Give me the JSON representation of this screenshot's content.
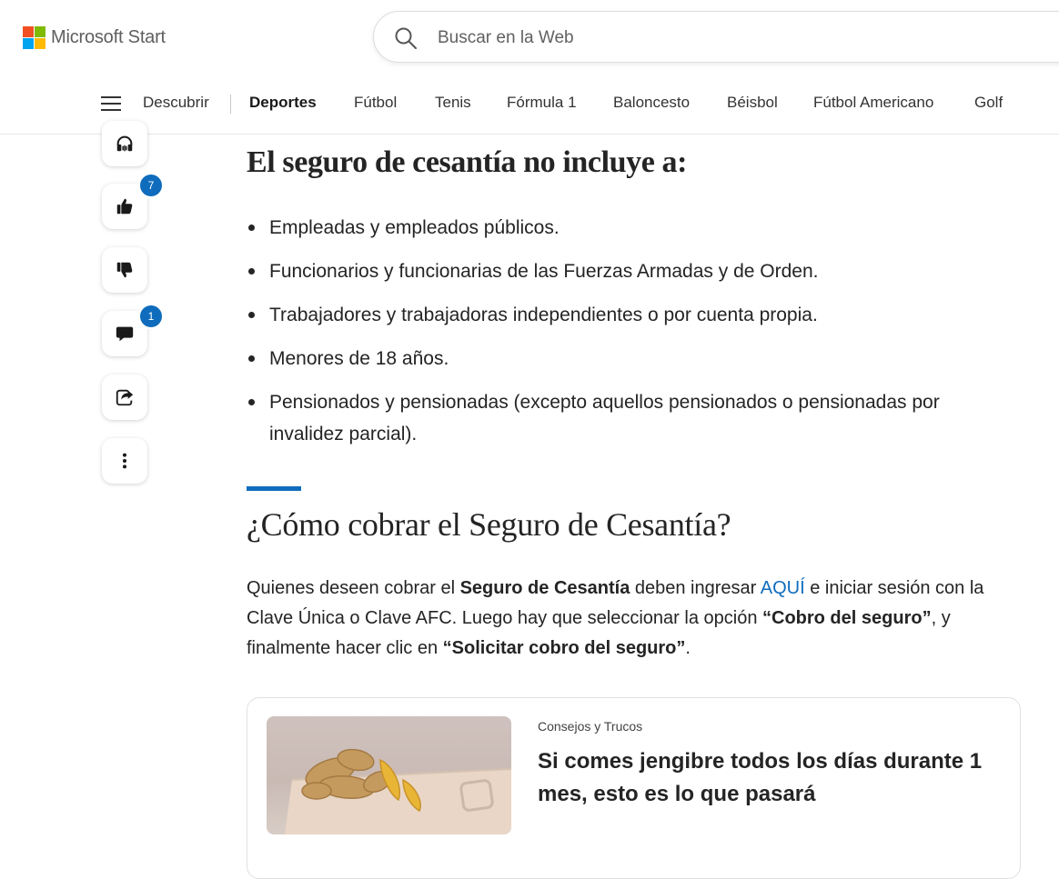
{
  "header": {
    "brand": "Microsoft Start",
    "search_placeholder": "Buscar en la Web",
    "logo_colors": [
      "#f25022",
      "#7fba00",
      "#00a4ef",
      "#ffb900"
    ]
  },
  "nav": {
    "items": [
      {
        "label": "Descubrir"
      },
      {
        "label": "Deportes",
        "active": true
      },
      {
        "label": "Fútbol"
      },
      {
        "label": "Tenis"
      },
      {
        "label": "Fórmula 1"
      },
      {
        "label": "Baloncesto"
      },
      {
        "label": "Béisbol"
      },
      {
        "label": "Fútbol Americano"
      },
      {
        "label": "Golf"
      }
    ]
  },
  "actions": {
    "listen_icon": "headphones-icon",
    "like_icon": "thumbs-up-icon",
    "like_count": "7",
    "dislike_icon": "thumbs-down-icon",
    "comment_icon": "comment-icon",
    "comment_count": "1",
    "share_icon": "share-icon",
    "more_icon": "more-vertical-icon",
    "badge_color": "#0f6cbd"
  },
  "article": {
    "subheading": "El seguro de cesantía no incluye a:",
    "exclusions": [
      "Empleadas y empleados públicos.",
      "Funcionarios y funcionarias de las Fuerzas Armadas y de Orden.",
      "Trabajadores y trabajadoras independientes o por cuenta propia.",
      "Menores de 18 años.",
      "Pensionados y pensionadas (excepto aquellos pensionados o pensionadas por invalidez parcial)."
    ],
    "section_heading": "¿Cómo cobrar el Seguro de Cesantía?",
    "paragraph": {
      "t1": "Quienes deseen cobrar el ",
      "b1": "Seguro de Cesantía",
      "t2": " deben ingresar ",
      "link": "AQUÍ",
      "t3": " e iniciar sesión con la Clave Única o Clave AFC. Luego hay que seleccionar la opción ",
      "b2": "“Cobro del seguro”",
      "t4": ", y finalmente hacer clic en ",
      "b3": "“Solicitar cobro del seguro”",
      "t5": "."
    },
    "accent_color": "#0f6cbd"
  },
  "related_card": {
    "category": "Consejos y Trucos",
    "title": "Si comes jengibre todos los días durante 1 mes, esto es lo que pasará"
  }
}
